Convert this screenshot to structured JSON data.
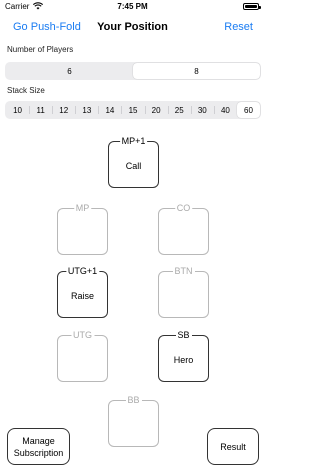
{
  "status": {
    "carrier": "Carrier",
    "time": "7:45 PM"
  },
  "nav": {
    "left": "Go Push-Fold",
    "title": "Your Position",
    "right": "Reset"
  },
  "players": {
    "label": "Number of Players",
    "options": [
      "6",
      "8"
    ],
    "selected": "8"
  },
  "stack": {
    "label": "Stack Size",
    "options": [
      "10",
      "11",
      "12",
      "13",
      "14",
      "15",
      "20",
      "25",
      "30",
      "40",
      "60"
    ],
    "selected": "60"
  },
  "seats": {
    "mp1": {
      "name": "MP+1",
      "action": "Call"
    },
    "mp": {
      "name": "MP",
      "action": ""
    },
    "co": {
      "name": "CO",
      "action": ""
    },
    "utg1": {
      "name": "UTG+1",
      "action": "Raise"
    },
    "btn": {
      "name": "BTN",
      "action": ""
    },
    "utg": {
      "name": "UTG",
      "action": ""
    },
    "sb": {
      "name": "SB",
      "action": "Hero"
    },
    "bb": {
      "name": "BB",
      "action": ""
    }
  },
  "buttons": {
    "manage": "Manage Subscription",
    "result": "Result"
  },
  "colors": {
    "accent": "#1a7cf2",
    "inactive_border": "#b8b8b8",
    "active_border": "#333333"
  }
}
